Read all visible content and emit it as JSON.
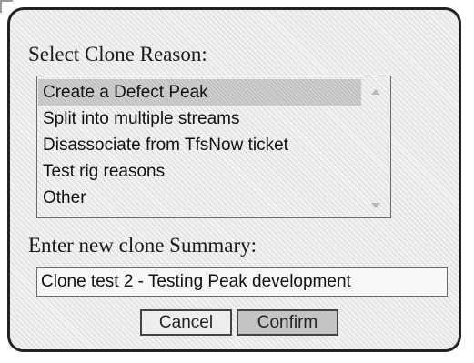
{
  "dialog": {
    "reason_label": "Select Clone Reason:",
    "reasons": [
      "Create a Defect Peak",
      "Split into multiple streams",
      "Disassociate from TfsNow ticket",
      "Test rig reasons",
      "Other"
    ],
    "selected_reason": "Create a Defect Peak",
    "summary_label": "Enter new clone Summary:",
    "summary_value": "Clone test 2 - Testing Peak development",
    "cancel_label": "Cancel",
    "confirm_label": "Confirm"
  },
  "icons": {
    "scroll_up": "chevron-up-icon",
    "scroll_down": "chevron-down-icon"
  },
  "colors": {
    "border": "#222222",
    "selection": "#cfcfcf",
    "confirm_button": "#c4c4c4"
  }
}
